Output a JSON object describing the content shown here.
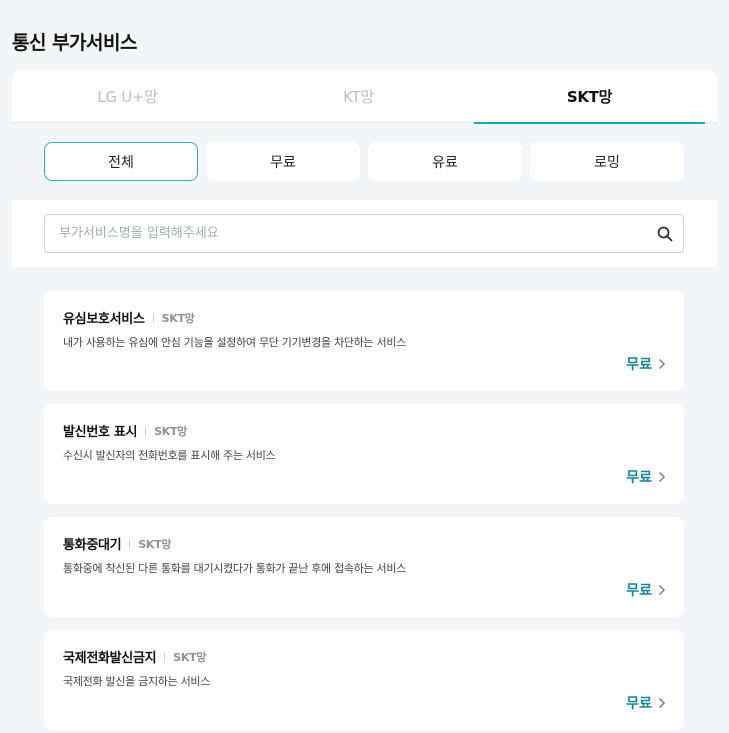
{
  "page_title": "통신 부가서비스",
  "tabs": [
    {
      "label": "LG U+망",
      "active": false
    },
    {
      "label": "KT망",
      "active": false
    },
    {
      "label": "SKT망",
      "active": true
    }
  ],
  "filters": [
    {
      "label": "전체",
      "active": true
    },
    {
      "label": "무료",
      "active": false
    },
    {
      "label": "유료",
      "active": false
    },
    {
      "label": "로밍",
      "active": false
    }
  ],
  "search": {
    "placeholder": "부가서비스명을 입력해주세요",
    "value": "",
    "icon": "search-icon"
  },
  "services": [
    {
      "name": "유심보호서비스",
      "network": "SKT망",
      "description": "내가 사용하는 유심에 안심 기능을 설정하여 무단 기기변경을 차단하는 서비스",
      "price": "무료"
    },
    {
      "name": "발신번호 표시",
      "network": "SKT망",
      "description": "수신시 발신자의 전화번호를 표시해 주는 서비스",
      "price": "무료"
    },
    {
      "name": "통화중대기",
      "network": "SKT망",
      "description": "통화중에 착신된 다른 통화를 대기시켰다가 통화가 끝난 후에 접속하는 서비스",
      "price": "무료"
    },
    {
      "name": "국제전화발신금지",
      "network": "SKT망",
      "description": "국제전화 발신을 금지하는 서비스",
      "price": "무료"
    }
  ],
  "colors": {
    "accent": "#1aa9bb",
    "price": "#16849a",
    "background": "#f3f5f8"
  }
}
